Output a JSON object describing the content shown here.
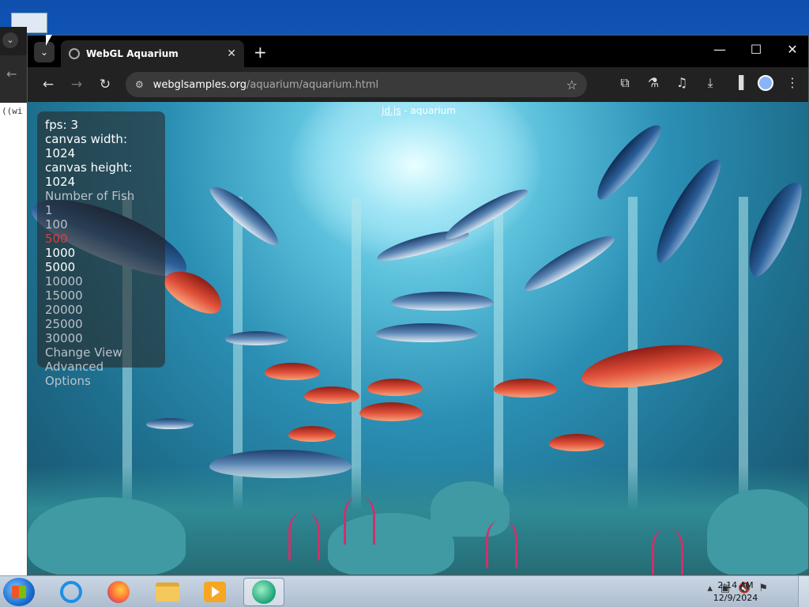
{
  "browser": {
    "tab_title": "WebGL Aquarium",
    "url_host": "webglsamples.org",
    "url_path": "/aquarium/aquarium.html"
  },
  "background_window": {
    "code_snippet": "((wi"
  },
  "aquarium": {
    "title_link": "jd.js",
    "title_suffix": " - aquarium",
    "stats": {
      "fps": "fps: 3",
      "canvas_width": "canvas width: 1024",
      "canvas_height": "canvas height: 1024"
    },
    "menu_heading": "Number of Fish",
    "fish_options": [
      "1",
      "100",
      "500",
      "1000",
      "5000",
      "10000",
      "15000",
      "20000",
      "25000",
      "30000"
    ],
    "selected_option": "500",
    "links": {
      "change_view": "Change View",
      "advanced": "Advanced",
      "options": "Options"
    }
  },
  "taskbar": {
    "time": "2:14 AM",
    "date": "12/9/2024"
  },
  "colors": {
    "hud_selected": "#e33b3b",
    "hud_text": "#ffffff",
    "hud_option": "#b9c2c9"
  }
}
